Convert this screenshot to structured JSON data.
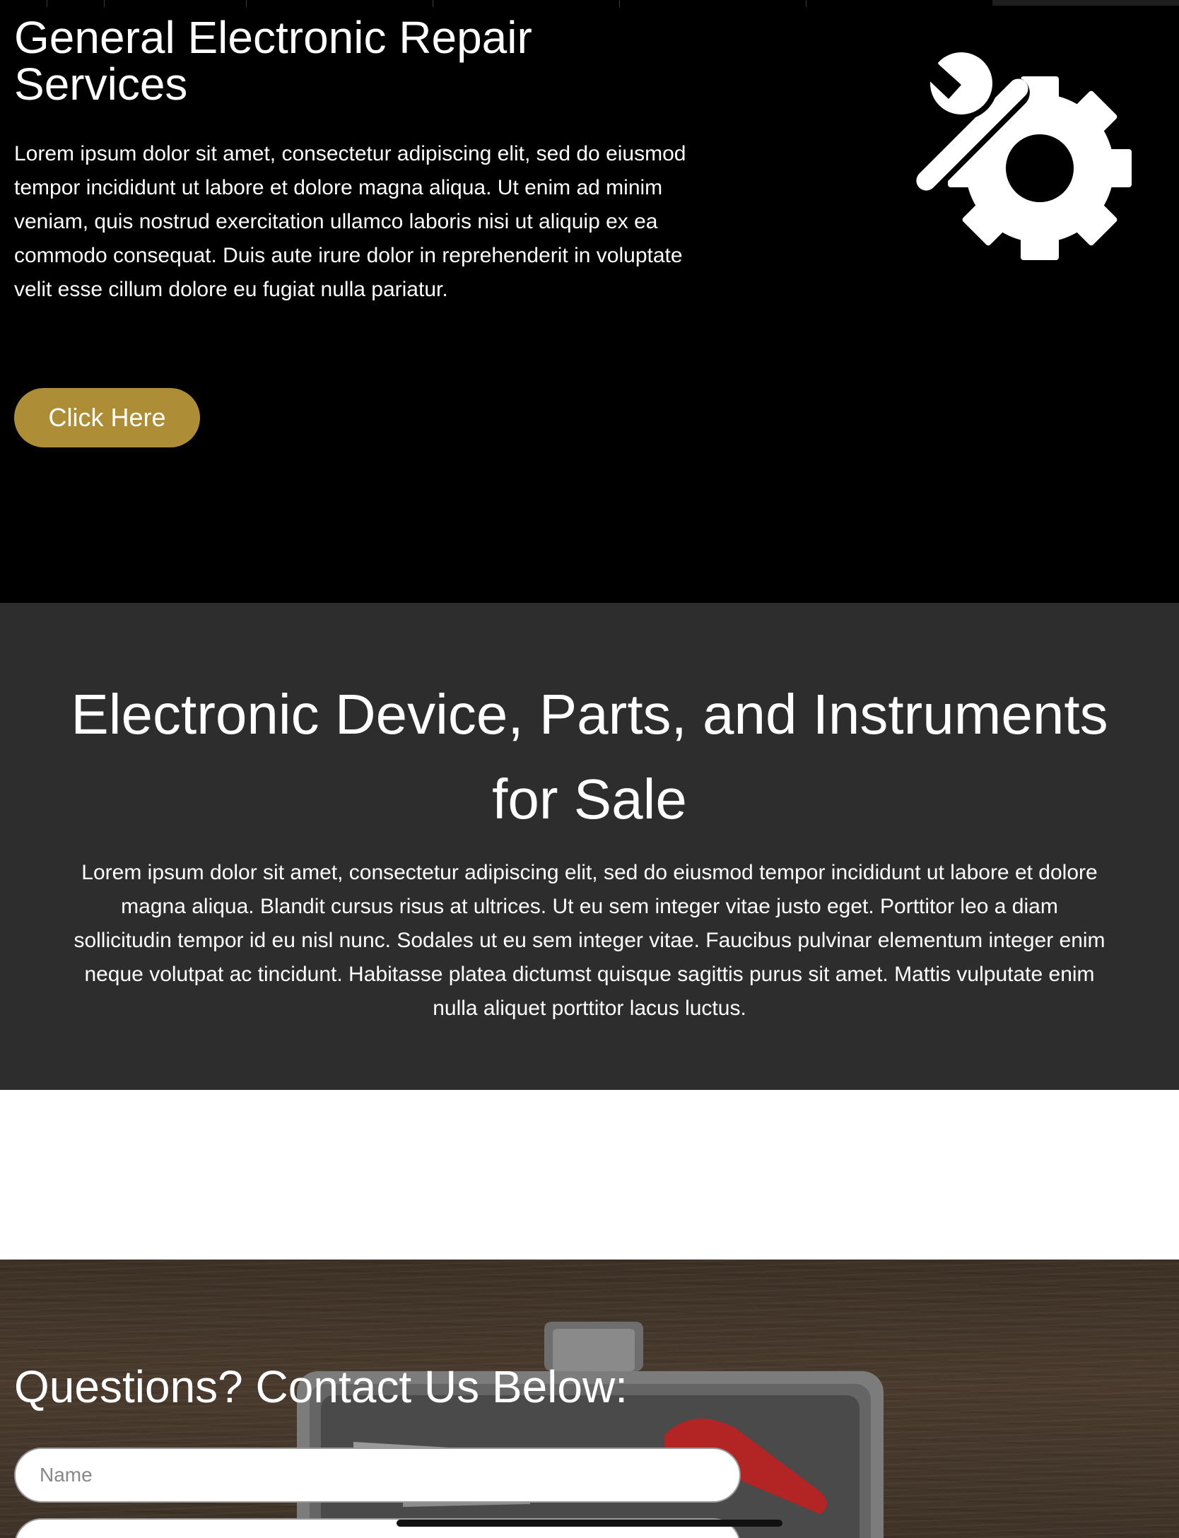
{
  "hero": {
    "title": "General Electronic Repair Services",
    "body": "Lorem ipsum dolor sit amet, consectetur adipiscing elit, sed do eiusmod tempor incididunt ut labore et dolore magna aliqua. Ut enim ad minim veniam, quis nostrud exercitation ullamco laboris nisi ut aliquip ex ea commodo consequat. Duis aute irure dolor in reprehenderit in voluptate velit esse cillum dolore eu fugiat nulla pariatur.",
    "button_label": "Click Here",
    "icon": "wrench-gear-icon"
  },
  "sale": {
    "title": "Electronic Device, Parts, and Instruments for Sale",
    "body": "Lorem ipsum dolor sit amet, consectetur adipiscing elit, sed do eiusmod tempor incididunt ut labore et dolore magna aliqua. Blandit cursus risus at ultrices. Ut eu sem integer vitae justo eget. Porttitor leo a diam sollicitudin tempor id eu nisl nunc. Sodales ut eu sem integer vitae. Faucibus pulvinar elementum integer enim neque volutpat ac tincidunt. Habitasse platea dictumst quisque sagittis purus sit amet. Mattis vulputate enim nulla aliquet porttitor lacus luctus."
  },
  "contact": {
    "title": "Questions? Contact Us Below:",
    "name_placeholder": "Name",
    "name_value": "",
    "email_placeholder": "",
    "email_value": ""
  },
  "colors": {
    "hero_bg": "#000000",
    "accent_button": "#ad8d35",
    "sale_bg": "#2d2d2d",
    "gap_bg": "#ffffff",
    "text": "#ffffff"
  }
}
